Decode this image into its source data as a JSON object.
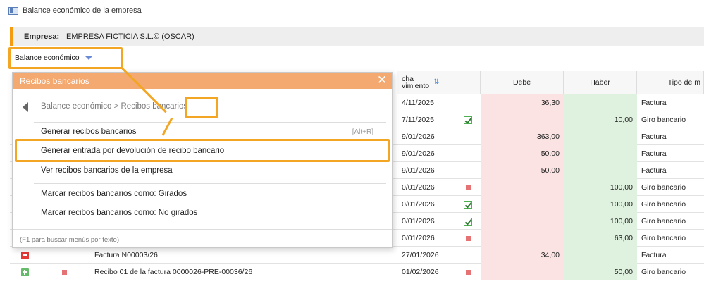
{
  "window": {
    "title": "Balance económico de la empresa"
  },
  "empresa": {
    "label": "Empresa:",
    "value": "EMPRESA FICTICIA S.L.© (OSCAR)"
  },
  "toolbar": {
    "balance_button_accel": "B",
    "balance_button_rest": "alance económico"
  },
  "table": {
    "headers": {
      "fecha_line1": "cha",
      "fecha_line2": "vimiento",
      "debe": "Debe",
      "haber": "Haber",
      "tipo": "Tipo de m"
    },
    "rows": [
      {
        "fecha": "4/11/2025",
        "check": "",
        "debe": "36,30",
        "haber": "",
        "tipo": "Factura",
        "desc": ""
      },
      {
        "fecha": "7/11/2025",
        "check": "green",
        "debe": "",
        "haber": "10,00",
        "tipo": "Giro bancario",
        "desc": ""
      },
      {
        "fecha": "9/01/2026",
        "check": "",
        "debe": "363,00",
        "haber": "",
        "tipo": "Factura",
        "desc": ""
      },
      {
        "fecha": "9/01/2026",
        "check": "",
        "debe": "50,00",
        "haber": "",
        "tipo": "Factura",
        "desc": ""
      },
      {
        "fecha": "9/01/2026",
        "check": "",
        "debe": "50,00",
        "haber": "",
        "tipo": "Factura",
        "desc": ""
      },
      {
        "fecha": "0/01/2026",
        "check": "red",
        "debe": "",
        "haber": "100,00",
        "tipo": "Giro bancario",
        "desc": ""
      },
      {
        "fecha": "0/01/2026",
        "check": "green",
        "debe": "",
        "haber": "100,00",
        "tipo": "Giro bancario",
        "desc": ""
      },
      {
        "fecha": "0/01/2026",
        "check": "green",
        "debe": "",
        "haber": "100,00",
        "tipo": "Giro bancario",
        "desc": ""
      },
      {
        "fecha": "0/01/2026",
        "check": "red",
        "debe": "",
        "haber": "63,00",
        "tipo": "Giro bancario",
        "desc": ""
      },
      {
        "fecha": "27/01/2026",
        "check": "",
        "debe": "34,00",
        "haber": "",
        "tipo": "Factura",
        "desc": "Factura N00003/26"
      },
      {
        "fecha": "01/02/2026",
        "check": "red",
        "debe": "",
        "haber": "50,00",
        "tipo": "Giro bancario",
        "desc": "Recibo 01 de la factura 0000026-PRE-00036/26"
      }
    ]
  },
  "popup": {
    "title": "Recibos bancarios",
    "breadcrumb": {
      "parent": "Balance económico",
      "separator": ">",
      "current": "Recibos bancarios"
    },
    "items": [
      {
        "label": "Generar recibos bancarios",
        "shortcut": "[Alt+R]"
      },
      {
        "label": "Generar entrada por devolución de recibo bancario",
        "shortcut": ""
      },
      {
        "label": "Ver recibos bancarios de la empresa",
        "shortcut": ""
      },
      {
        "label": "Marcar recibos bancarios como: Girados",
        "shortcut": ""
      },
      {
        "label": "Marcar recibos bancarios como: No girados",
        "shortcut": ""
      }
    ],
    "footer": "(F1 para buscar menús por texto)"
  },
  "colors": {
    "accent_orange": "#f2a623",
    "popup_header": "#f4a971",
    "debe_bg": "#fbe3e3",
    "haber_bg": "#dff1df"
  }
}
